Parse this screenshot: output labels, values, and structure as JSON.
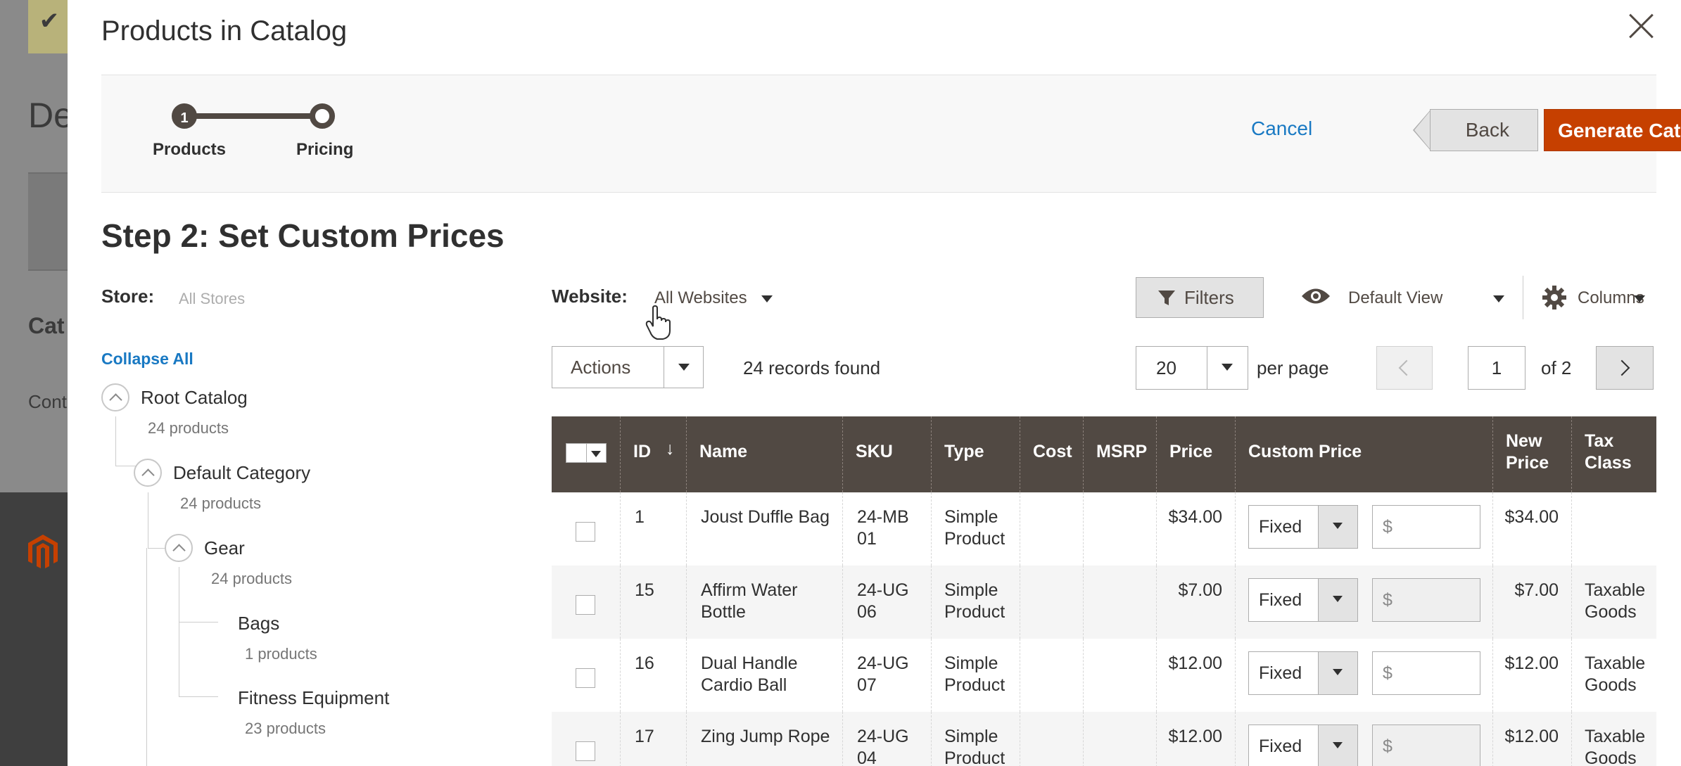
{
  "background": {
    "title_fragment": "De",
    "section_fragment": "Cat",
    "content_fragment": "Cont"
  },
  "modal": {
    "title": "Products in Catalog",
    "wizard": {
      "steps": [
        {
          "number": "1",
          "label": "Products"
        },
        {
          "number": "",
          "label": "Pricing"
        }
      ]
    },
    "actions": {
      "cancel": "Cancel",
      "back": "Back",
      "generate": "Generate Catalog"
    },
    "step_heading": "Step 2: Set Custom Prices",
    "store": {
      "label": "Store:",
      "value": "All Stores"
    },
    "collapse_all": "Collapse All",
    "tree": [
      {
        "name": "Root Catalog",
        "count": "24 products"
      },
      {
        "name": "Default Category",
        "count": "24 products"
      },
      {
        "name": "Gear",
        "count": "24 products"
      },
      {
        "name": "Bags",
        "count": "1 products"
      },
      {
        "name": "Fitness Equipment",
        "count": "23 products"
      }
    ],
    "website": {
      "label": "Website:",
      "value": "All Websites"
    },
    "toolbar": {
      "filters": "Filters",
      "view": "Default View",
      "columns": "Columns",
      "actions": "Actions",
      "records": "24 records found",
      "per_page_value": "20",
      "per_page_label": "per page",
      "page": "1",
      "of_pages": "of 2"
    },
    "grid": {
      "columns": [
        "ID",
        "Name",
        "SKU",
        "Type",
        "Cost",
        "MSRP",
        "Price",
        "Custom Price",
        "New Price",
        "Tax Class"
      ],
      "sort_indicator": "↓",
      "custom_price_type": "Fixed",
      "custom_price_placeholder": "$",
      "rows": [
        {
          "id": "1",
          "name": "Joust Duffle Bag",
          "sku": "24-MB01",
          "type": "Simple Product",
          "cost": "",
          "msrp": "",
          "price": "$34.00",
          "new_price": "$34.00",
          "tax_class": ""
        },
        {
          "id": "15",
          "name": "Affirm Water Bottle",
          "sku": "24-UG06",
          "type": "Simple Product",
          "cost": "",
          "msrp": "",
          "price": "$7.00",
          "new_price": "$7.00",
          "tax_class": "Taxable Goods"
        },
        {
          "id": "16",
          "name": "Dual Handle Cardio Ball",
          "sku": "24-UG07",
          "type": "Simple Product",
          "cost": "",
          "msrp": "",
          "price": "$12.00",
          "new_price": "$12.00",
          "tax_class": "Taxable Goods"
        },
        {
          "id": "17",
          "name": "Zing Jump Rope",
          "sku": "24-UG04",
          "type": "Simple Product",
          "cost": "",
          "msrp": "",
          "price": "$12.00",
          "new_price": "$12.00",
          "tax_class": "Taxable Goods"
        }
      ]
    }
  },
  "colors": {
    "accent": "#c64000",
    "link": "#1979c3",
    "grid_header": "#514943"
  },
  "icons": [
    "close-icon",
    "filter-icon",
    "eye-icon",
    "gear-icon",
    "chevron-down-icon",
    "chevron-left-icon",
    "chevron-right-icon",
    "hand-cursor-icon",
    "magento-logo-icon"
  ]
}
